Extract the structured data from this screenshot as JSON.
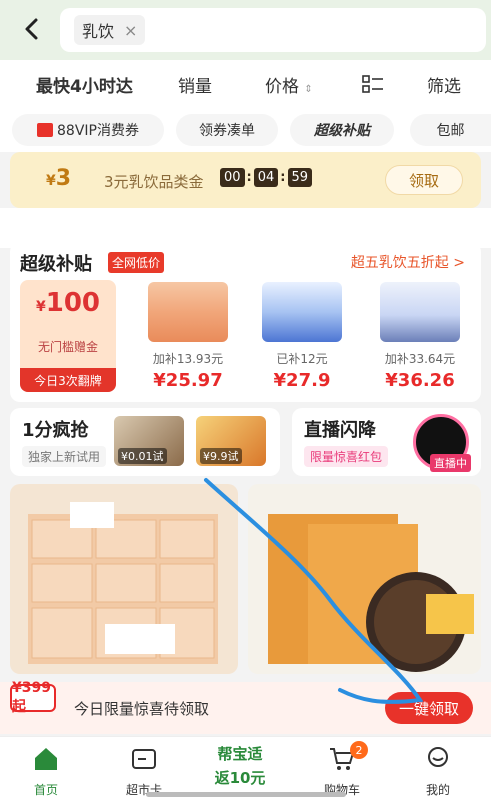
{
  "search": {
    "chip": "乳饮",
    "close": "×"
  },
  "sort": {
    "fastest": "最快4小时达",
    "sales": "销量",
    "price": "价格",
    "filter": "筛选"
  },
  "filters": [
    "88VIP消费券",
    "领券凑单",
    "超级补贴",
    "包邮"
  ],
  "coupon": {
    "amount": "3",
    "currency": "¥",
    "desc": "3元乳饮品类金",
    "time": [
      "00",
      "04",
      "59"
    ],
    "claim": "领取"
  },
  "super": {
    "title": "超级补贴",
    "badge": "全网低价",
    "more": "超五乳饮五折起 >",
    "bonus": {
      "currency": "¥",
      "amount": "100",
      "label": "无门槛赠金",
      "footer": "今日3次翻牌"
    },
    "products": [
      {
        "sub": "加补13.93元",
        "price": "¥25.97"
      },
      {
        "sub": "已补12元",
        "price": "¥27.9"
      },
      {
        "sub": "加补33.64元",
        "price": "¥36.26"
      }
    ]
  },
  "flash": {
    "title": "1分疯抢",
    "subtitle": "独家上新试用",
    "thumbs": [
      "¥0.01试",
      "¥9.9试"
    ]
  },
  "live": {
    "title": "直播闪降",
    "subtitle": "限量惊喜红包",
    "tag": "直播中"
  },
  "promo": {
    "price": "¥399起",
    "text": "今日限量惊喜待领取",
    "button": "一键领取"
  },
  "tabbar": {
    "home": "首页",
    "card": "超市卡",
    "promo_line1": "帮宝适",
    "promo_line2": "返10元",
    "cart": "购物车",
    "cart_badge": "2",
    "me": "我的"
  },
  "colors": {
    "brand_green": "#2a8a3a",
    "accent_red": "#e82a2a",
    "annotation": "#2b8fe0"
  }
}
